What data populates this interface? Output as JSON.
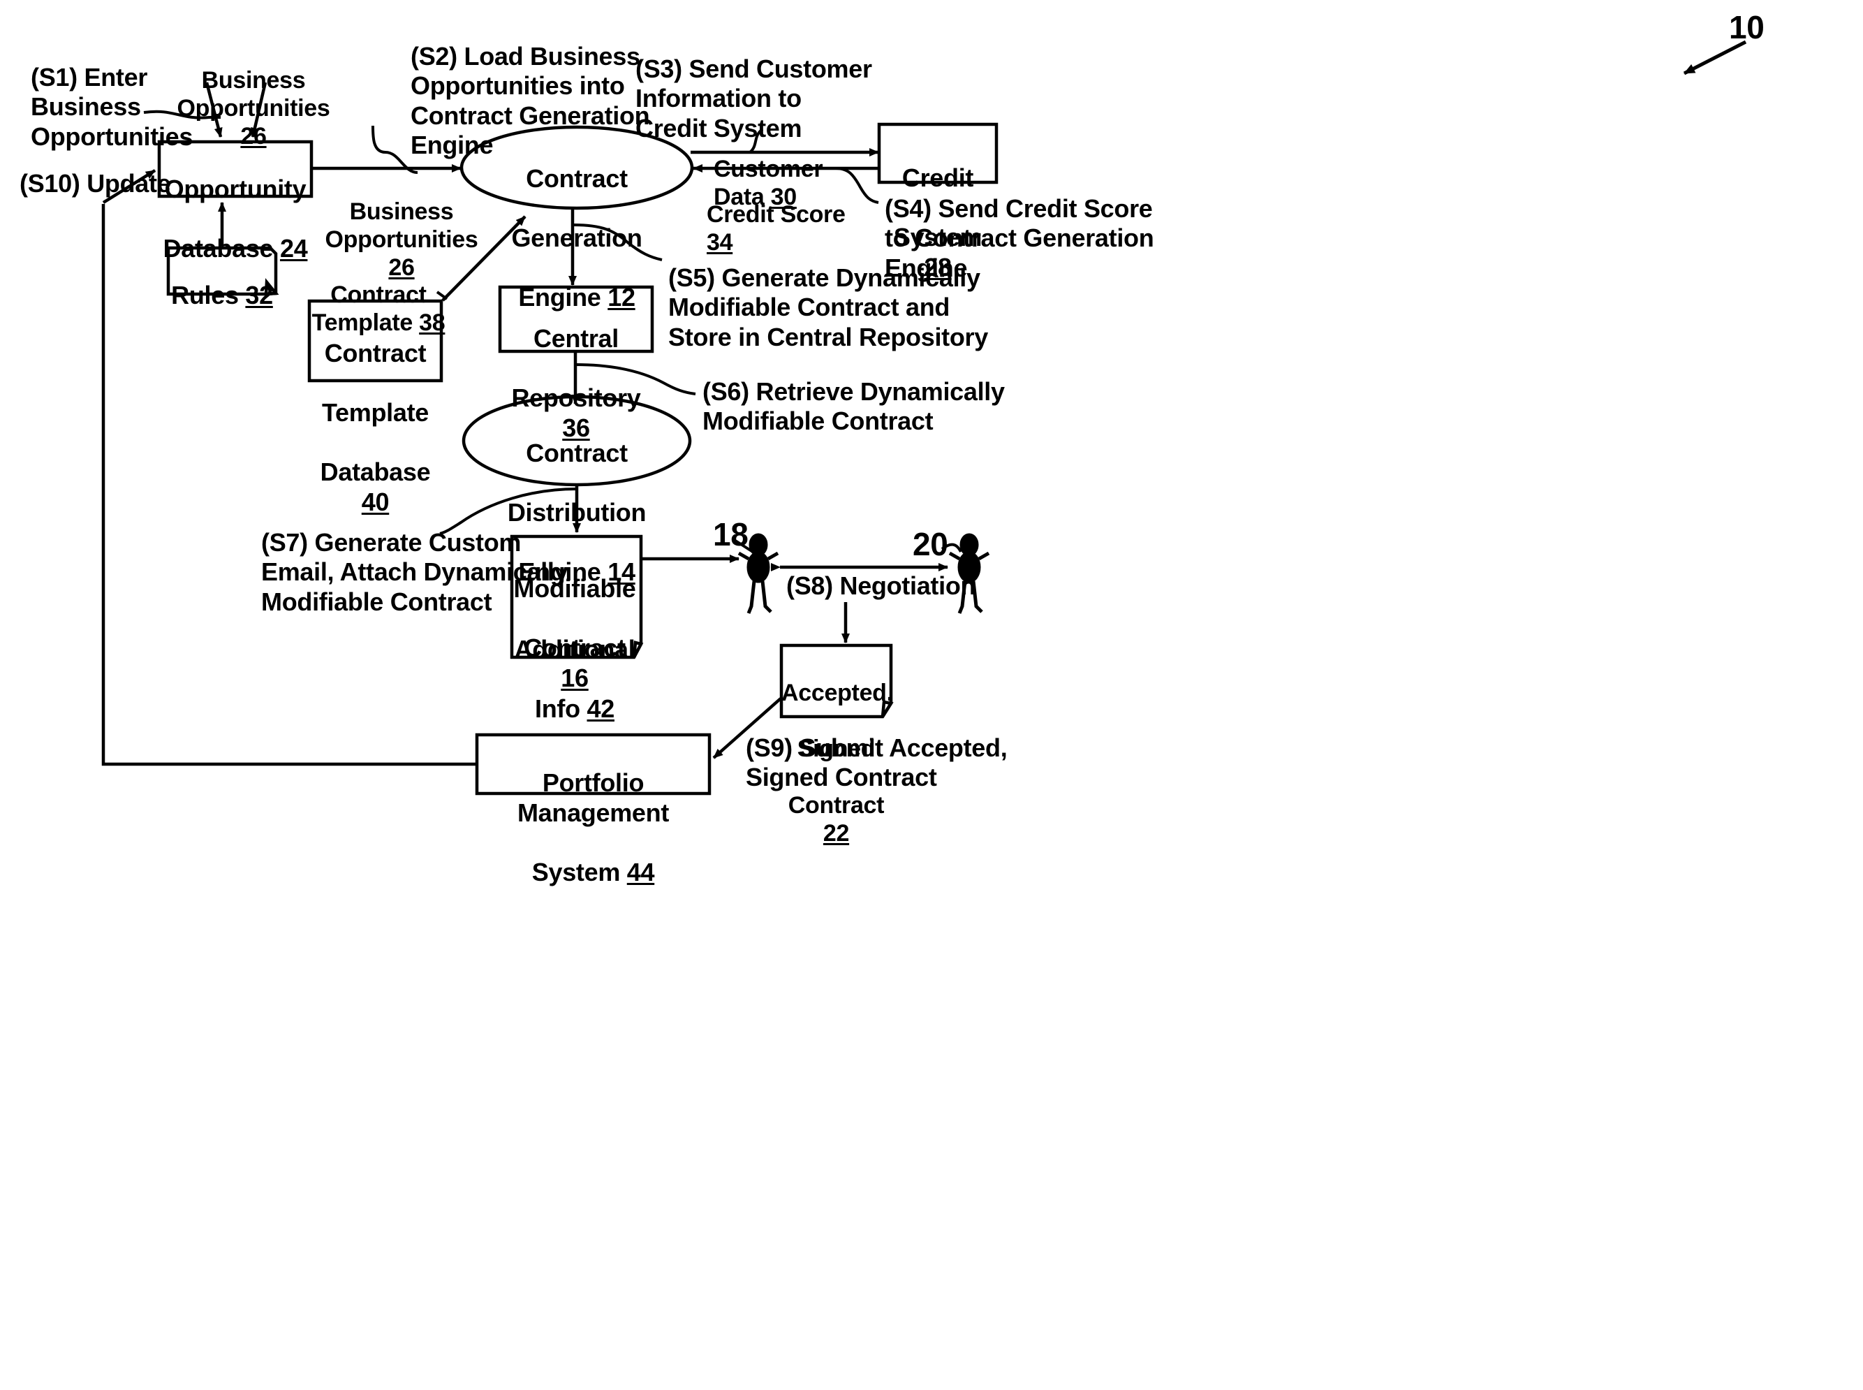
{
  "figure": {
    "reference_numeral": "10"
  },
  "nodes": {
    "opportunity_database": {
      "line1": "Opportunity",
      "line2": "Database ",
      "ref": "24"
    },
    "rules": {
      "line1": "Rules ",
      "ref": "32"
    },
    "contract_generation_engine": {
      "line1": "Contract",
      "line2": "Generation",
      "line3": "Engine ",
      "ref": "12"
    },
    "credit_system": {
      "line1": "Credit",
      "line2": "System ",
      "ref": "28"
    },
    "contract_template_database": {
      "line1": "Contract",
      "line2": "Template",
      "line3": "Database ",
      "ref": "40"
    },
    "central_repository": {
      "line1": "Central",
      "line2": "Repository ",
      "ref": "36"
    },
    "contract_distribution_engine": {
      "line1": "Contract",
      "line2": "Distribution",
      "line3": "Engine ",
      "ref": "14"
    },
    "modifiable_contract": {
      "line1": "Modifiable",
      "line2": "Contract ",
      "ref": "16",
      "line3": "Additional",
      "line4": "Info ",
      "ref2": "42"
    },
    "accepted_signed_contract": {
      "line1": "Accepted,",
      "line2": "Signed",
      "line3": "Contract ",
      "ref": "22"
    },
    "portfolio_management_system": {
      "line1": "Portfolio Management",
      "line2": "System ",
      "ref": "44"
    }
  },
  "actors": {
    "actor_left": {
      "ref": "18"
    },
    "actor_right": {
      "ref": "20"
    }
  },
  "flow_labels": {
    "business_opportunities_top": {
      "text": "Business\nOpportunities ",
      "ref": "26"
    },
    "business_opportunities_mid": {
      "text": "Business\nOpportunities ",
      "ref": "26"
    },
    "customer_data": {
      "text": "Customer Data ",
      "ref": "30"
    },
    "credit_score": {
      "text": "Credit Score ",
      "ref": "34"
    },
    "contract_template": {
      "text": "Contract\nTemplate ",
      "ref": "38"
    }
  },
  "steps": {
    "s1": "(S1) Enter\nBusiness\nOpportunities",
    "s2": "(S2) Load Business\nOpportunities into\nContract Generation\nEngine",
    "s3": "(S3) Send Customer\nInformation to\nCredit System",
    "s4": "(S4) Send Credit Score\nto Contract Generation\nEngine",
    "s5": "(S5) Generate Dynamically\nModifiable Contract and\nStore in Central Repository",
    "s6": "(S6) Retrieve Dynamically\nModifiable Contract",
    "s7": "(S7) Generate Custom\nEmail, Attach Dynamically\nModifiable Contract",
    "s8": "(S8) Negotiation",
    "s9": "(S9) Submit Accepted,\nSigned Contract",
    "s10": "(S10) Update"
  },
  "colors": {
    "ink": "#000000",
    "background": "#ffffff"
  }
}
